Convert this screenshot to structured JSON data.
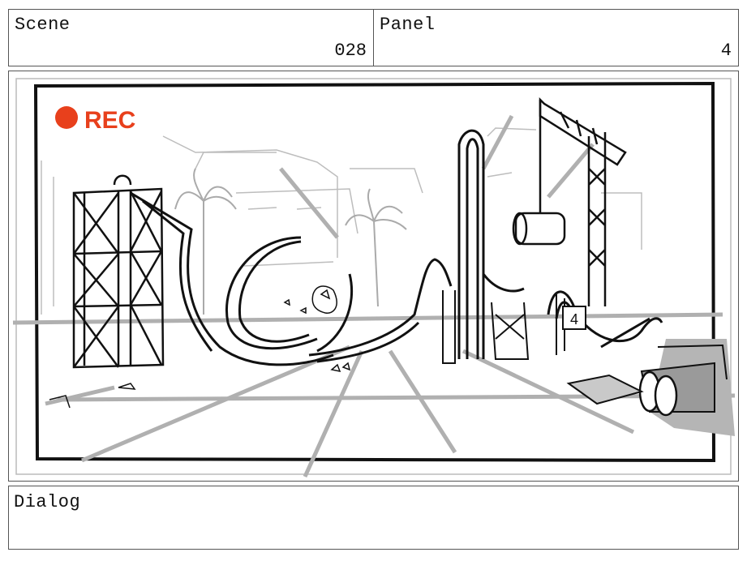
{
  "scene": {
    "label": "Scene",
    "number": "028"
  },
  "panel": {
    "label": "Panel",
    "number": "4"
  },
  "frame": {
    "rec_label": "REC",
    "rec_color": "#e8401c",
    "sign_number": "4"
  },
  "dialog": {
    "label": "Dialog",
    "text": ""
  }
}
